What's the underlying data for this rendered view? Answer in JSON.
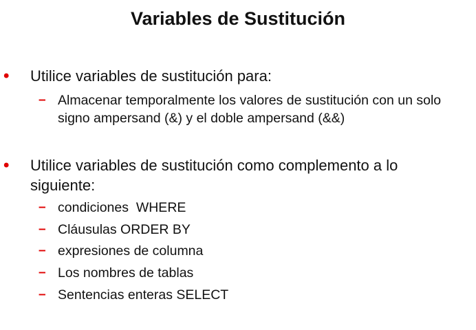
{
  "slide": {
    "title": "Variables de Sustitución",
    "accent_color": "#e00000",
    "bullet_symbol": "•",
    "dash_symbol": "–",
    "bullets": [
      {
        "text": "Utilice variables de sustitución para:",
        "subitems": [
          "Almacenar temporalmente los valores de sustitución con un solo signo ampersand (&) y el doble ampersand (&&)"
        ]
      },
      {
        "text": "Utilice variables de sustitución como complemento a lo siguiente:",
        "subitems": [
          "condiciones  WHERE",
          "Cláusulas ORDER BY",
          "expresiones de columna",
          "Los nombres de tablas",
          "Sentencias enteras SELECT"
        ]
      }
    ]
  }
}
